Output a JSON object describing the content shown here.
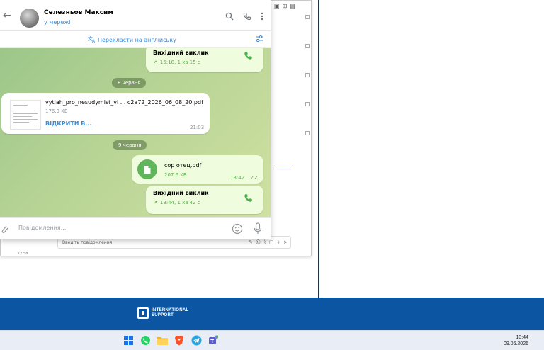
{
  "chat": {
    "contact_name": "Селезньов Максим",
    "contact_status": "у мережі",
    "translate_bar": "Перекласти на англійську",
    "input_placeholder": "Повідомлення..."
  },
  "messages": {
    "call1": {
      "title": "Вихідний виклик",
      "meta": "15:18, 1 хв 15 с"
    },
    "date1": "8 червня",
    "file1": {
      "name": "vytiah_pro_nesudymist_vi ... c2a72_2026_06_08_20.pdf",
      "size": "176.3 KB",
      "action": "ВІДКРИТИ В...",
      "time": "21:03"
    },
    "date2": "9 червня",
    "file2": {
      "name": "cop отец.pdf",
      "size": "207.6 KB",
      "time": "13:42"
    },
    "call2": {
      "title": "Вихідний виклик",
      "meta": "13:44, 1 хв 42 с"
    }
  },
  "background": {
    "input_placeholder": "Введіть повідомлення",
    "timestamp": "12:58"
  },
  "banner": {
    "line1": "INTERNATIONAL",
    "line2": "SUPPORT"
  },
  "taskbar": {
    "time": "13:44",
    "date": "09.06.2026",
    "apps": [
      "windows-start-icon",
      "whatsapp-icon",
      "file-explorer-icon",
      "brave-browser-icon",
      "telegram-icon",
      "teams-icon"
    ]
  },
  "colors": {
    "accent": "#3a8bd7",
    "outgoing_bubble": "#effdde",
    "call_green": "#4fae4e",
    "banner": "#0b55a3"
  }
}
